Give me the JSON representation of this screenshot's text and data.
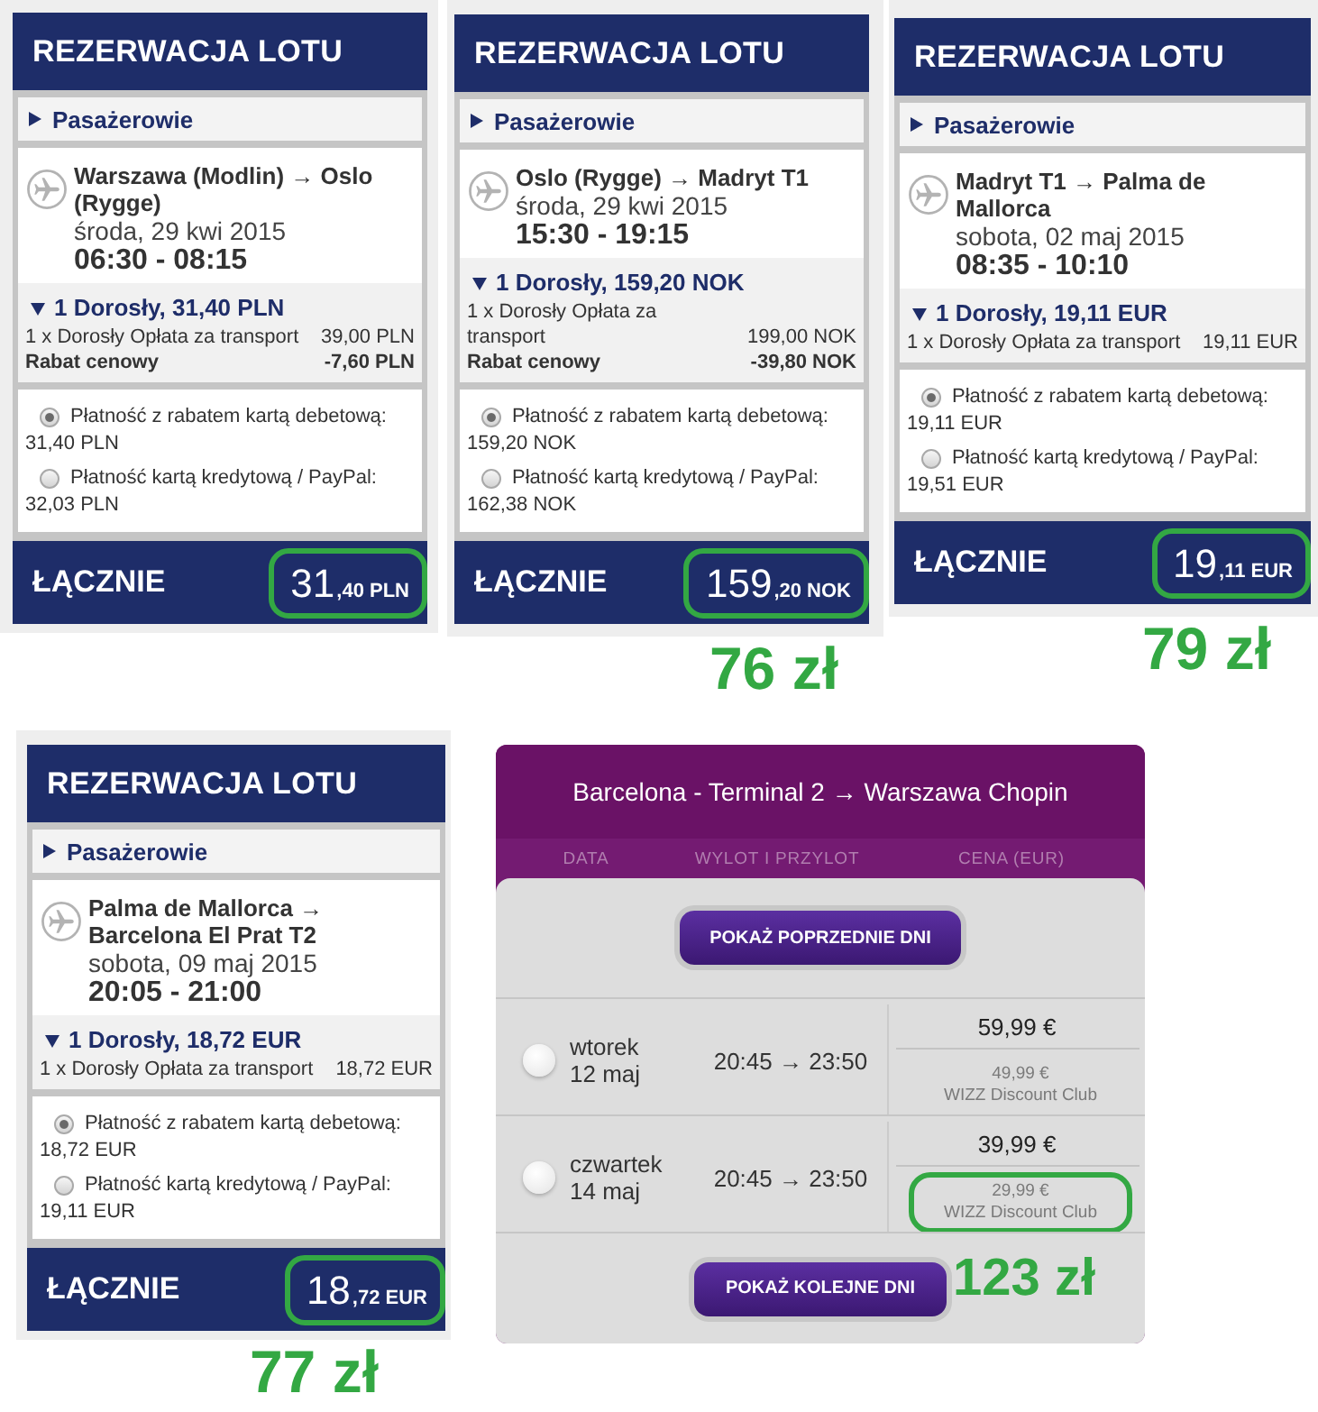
{
  "booking_cards": [
    {
      "title": "REZERWACJA LOTU",
      "passengers": {
        "label": "Pasażerowie",
        "expanded": false
      },
      "flight": {
        "route": "Warszawa (Modlin) → Oslo (Rygge)",
        "date": "środa, 29 kwi 2015",
        "times": "06:30 - 08:15"
      },
      "fare": {
        "summary": "1 Dorosły, 31,40 PLN",
        "expanded": true,
        "lines": [
          {
            "kind": "fee",
            "label": "1 x Dorosły Opłata za transport",
            "amount": "39,00 PLN"
          },
          {
            "kind": "discount",
            "label": "Rabat cenowy",
            "amount": "-7,60 PLN"
          }
        ]
      },
      "payment_options": [
        {
          "label": "Płatność z rabatem kartą debetową:",
          "amount": "31,40 PLN",
          "selected": true
        },
        {
          "label": "Płatność kartą kredytową / PayPal:",
          "amount": "32,03 PLN",
          "selected": false
        }
      ],
      "total": {
        "label": "ŁĄCZNIE",
        "amount_major": "31",
        "amount_minor": ",40 PLN",
        "highlighted": true
      }
    },
    {
      "title": "REZERWACJA LOTU",
      "passengers": {
        "label": "Pasażerowie",
        "expanded": false
      },
      "flight": {
        "route": "Oslo (Rygge) → Madryt T1",
        "date": "środa, 29 kwi 2015",
        "times": "15:30 - 19:15"
      },
      "fare": {
        "summary": "1 Dorosły, 159,20 NOK",
        "expanded": true,
        "lines": [
          {
            "kind": "fee",
            "label": "1 x Dorosły Opłata za transport",
            "amount": "199,00 NOK"
          },
          {
            "kind": "discount",
            "label": "Rabat cenowy",
            "amount": "-39,80 NOK"
          }
        ]
      },
      "payment_options": [
        {
          "label": "Płatność z rabatem kartą debetową:",
          "amount": "159,20 NOK",
          "selected": true
        },
        {
          "label": "Płatność kartą kredytową / PayPal:",
          "amount": "162,38 NOK",
          "selected": false
        }
      ],
      "total": {
        "label": "ŁĄCZNIE",
        "amount_major": "159",
        "amount_minor": ",20 NOK",
        "highlighted": true
      },
      "note": "76 zł"
    },
    {
      "title": "REZERWACJA LOTU",
      "passengers": {
        "label": "Pasażerowie",
        "expanded": false
      },
      "flight": {
        "route": "Madryt T1 → Palma de Mallorca",
        "date": "sobota, 02 maj 2015",
        "times": "08:35 - 10:10"
      },
      "fare": {
        "summary": "1 Dorosły, 19,11 EUR",
        "expanded": true,
        "lines": [
          {
            "kind": "fee",
            "label": "1 x Dorosły Opłata za transport",
            "amount": "19,11 EUR"
          }
        ]
      },
      "payment_options": [
        {
          "label": "Płatność z rabatem kartą debetową:",
          "amount": "19,11 EUR",
          "selected": true
        },
        {
          "label": "Płatność kartą kredytową / PayPal:",
          "amount": "19,51 EUR",
          "selected": false
        }
      ],
      "total": {
        "label": "ŁĄCZNIE",
        "amount_major": "19",
        "amount_minor": ",11 EUR",
        "highlighted": true
      },
      "note": "79 zł"
    },
    {
      "title": "REZERWACJA LOTU",
      "passengers": {
        "label": "Pasażerowie",
        "expanded": false
      },
      "flight": {
        "route": "Palma de Mallorca → Barcelona El Prat T2",
        "date": "sobota, 09 maj 2015",
        "times": "20:05 - 21:00"
      },
      "fare": {
        "summary": "1 Dorosły, 18,72 EUR",
        "expanded": true,
        "lines": [
          {
            "kind": "fee",
            "label": "1 x Dorosły Opłata za transport",
            "amount": "18,72 EUR"
          }
        ]
      },
      "payment_options": [
        {
          "label": "Płatność z rabatem kartą debetową:",
          "amount": "18,72 EUR",
          "selected": true
        },
        {
          "label": "Płatność kartą kredytową / PayPal:",
          "amount": "19,11 EUR",
          "selected": false
        }
      ],
      "total": {
        "label": "ŁĄCZNIE",
        "amount_major": "18",
        "amount_minor": ",72 EUR",
        "highlighted": true
      },
      "note": "77 zł"
    }
  ],
  "fare_table": {
    "title": "Barcelona - Terminal 2 → Warszawa Chopin",
    "columns": [
      "DATA",
      "WYLOT I PRZYLOT",
      "CENA (EUR)"
    ],
    "previous_button": "POKAŻ POPRZEDNIE DNI",
    "rows": [
      {
        "day": "wtorek",
        "date": "12 maj",
        "times": "20:45 → 23:50",
        "price": "59,99 €",
        "club_price": "49,99 €",
        "club_label": "WIZZ Discount Club",
        "selected": false,
        "highlighted": false
      },
      {
        "day": "czwartek",
        "date": "14 maj",
        "times": "20:45 → 23:50",
        "price": "39,99 €",
        "club_price": "29,99 €",
        "club_label": "WIZZ Discount Club",
        "selected": false,
        "highlighted": true
      }
    ],
    "next_button": "POKAŻ KOLEJNE DNI",
    "note": "123 zł"
  }
}
